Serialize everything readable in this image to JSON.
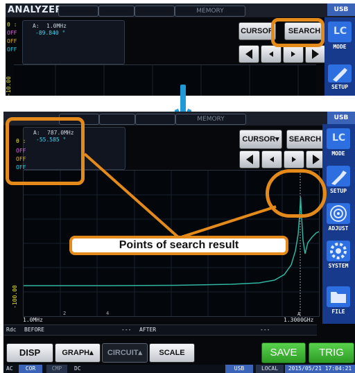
{
  "top": {
    "app_title": "ANALYZER",
    "memory_label": "MEMORY",
    "usb_label": "USB",
    "readout": {
      "freq_label": "A:",
      "freq_value": "1.0MHz",
      "theta_label": "θ :",
      "theta_value": "-89.840 °",
      "off1": "OFF",
      "off2": "OFF",
      "off3": "OFF"
    },
    "cursor_label": "CURSOR",
    "search_label": "SEARCH",
    "y_axis_label": "-10.00",
    "side": {
      "mode_label": "MODE",
      "setup_label": "SETUP"
    }
  },
  "bottom": {
    "memory_label": "MEMORY",
    "usb_label": "USB",
    "readout": {
      "freq_label": "A:",
      "freq_value": "787.0MHz",
      "theta_label": "θ :",
      "theta_value": "-55.585 °",
      "off1": "OFF",
      "off2": "OFF",
      "off3": "OFF"
    },
    "cursor_label": "CURSOR▾",
    "search_label": "SEARCH",
    "y_axis_label": "-100.00",
    "x_start_label": "1.0MHz",
    "x_end_label": "1.3000GHz",
    "x_tick_2": "2",
    "x_tick_4": "4",
    "x_tick_a": "A",
    "status_rdc": "Rdc",
    "status_before": "BEFORE",
    "status_dash1": "---",
    "status_after": "AFTER",
    "status_dash2": "---",
    "callout": "Points of search result",
    "buttons": {
      "disp": "DISP",
      "graph": "GRAPH▴",
      "circuit": "CIRCUIT▴",
      "scale": "SCALE",
      "save": "SAVE",
      "trig": "TRIG"
    },
    "side": {
      "mode_label": "MODE",
      "setup_label": "SETUP",
      "adjust_label": "ADJUST",
      "system_label": "SYSTEM",
      "file_label": "FILE"
    },
    "footer": {
      "ac": "AC",
      "cor": "COR",
      "cmp": "CMP",
      "dc": "DC",
      "usb": "USB",
      "local": "LOCAL",
      "datetime": "2015/05/21 17:04:21"
    }
  },
  "colors": {
    "highlight": "#e48a1b",
    "trace": "#2fb7a2",
    "readout_value": "#45d4ee",
    "side_bar": "#173a8c",
    "save_trig": "#3cb032",
    "arrow": "#1f9ad6"
  }
}
